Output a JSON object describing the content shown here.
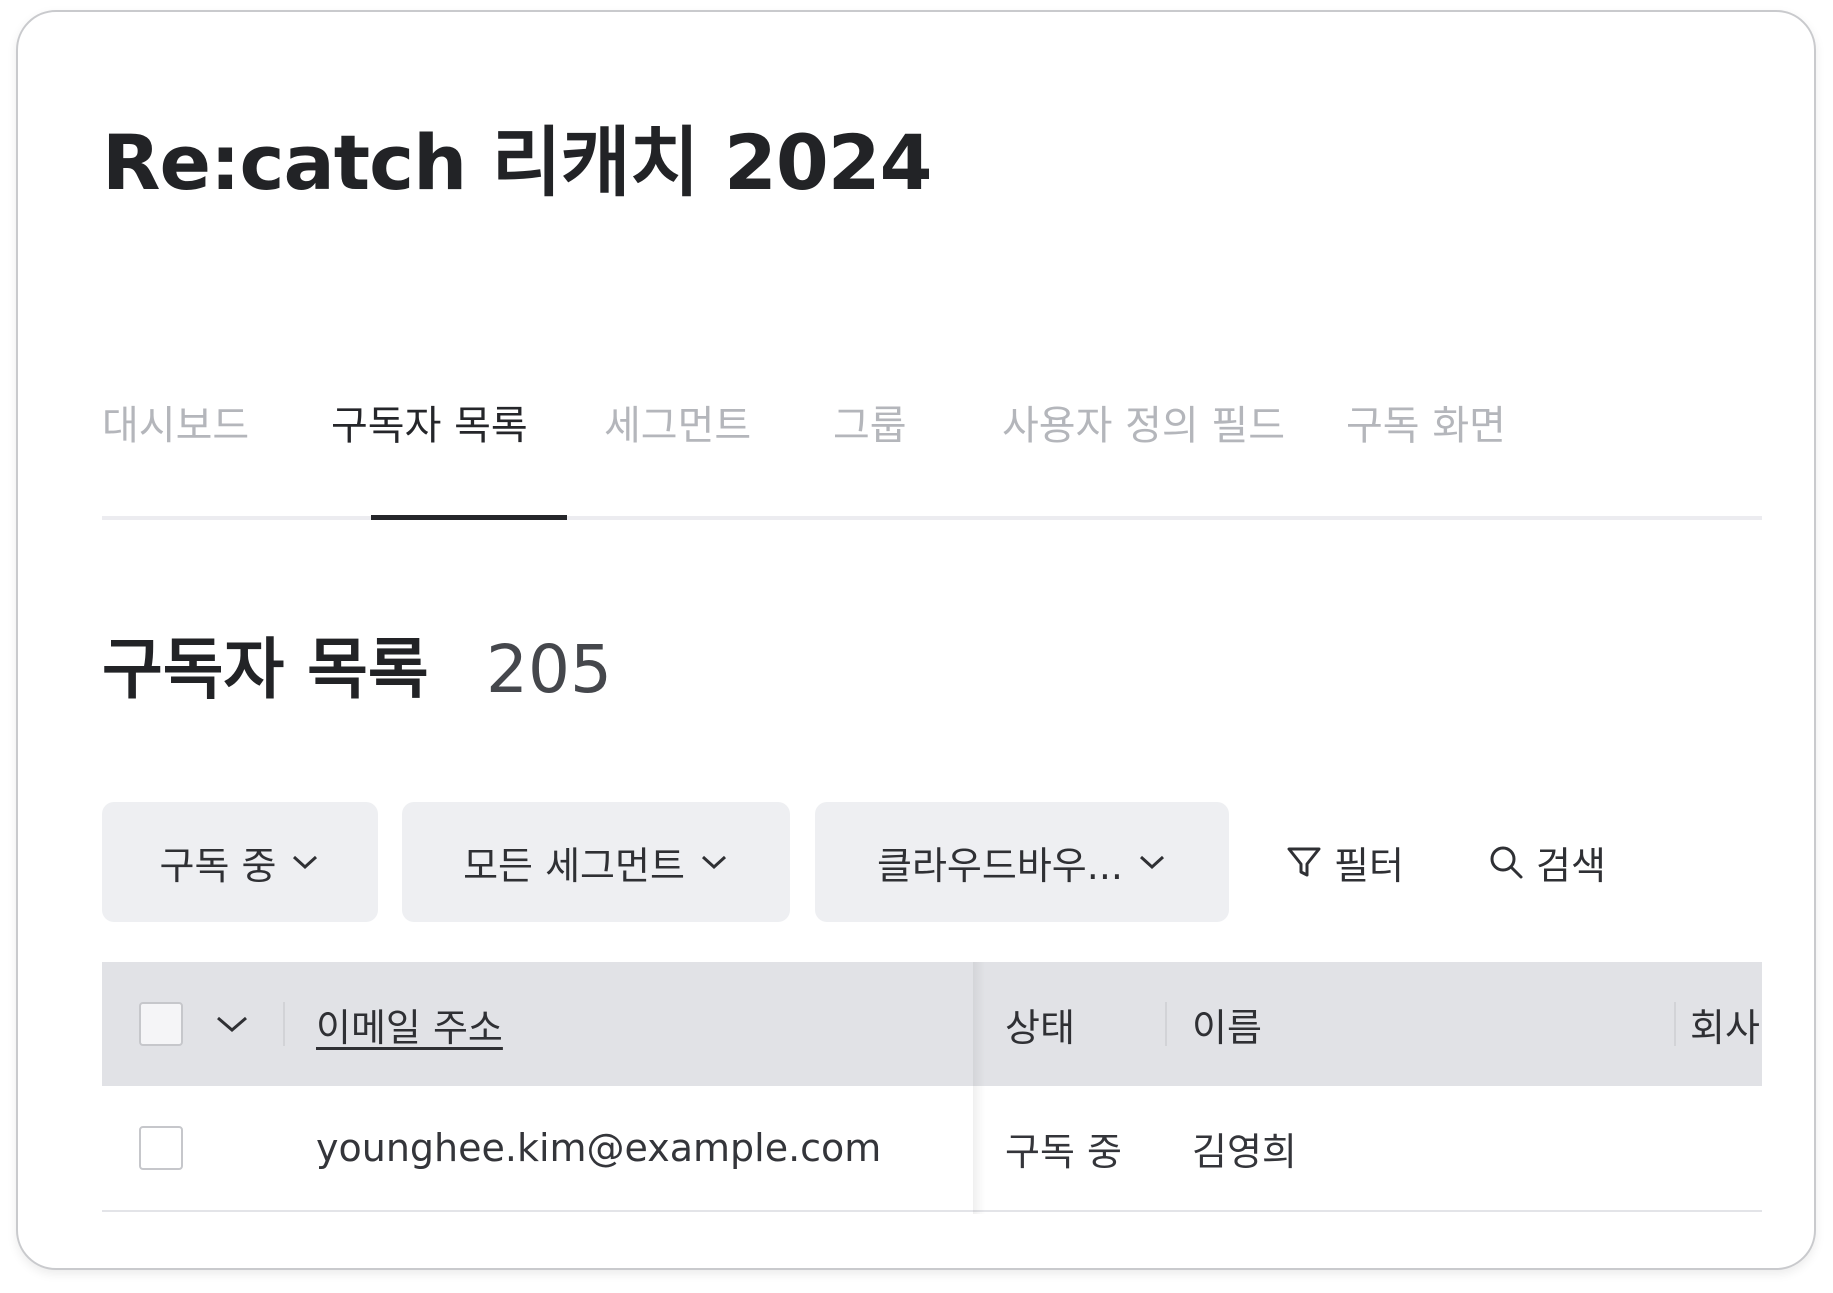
{
  "page": {
    "title": "Re:catch 리캐치 2024"
  },
  "tabs": [
    {
      "label": "대시보드",
      "active": false
    },
    {
      "label": "구독자 목록",
      "active": true
    },
    {
      "label": "세그먼트",
      "active": false
    },
    {
      "label": "그룹",
      "active": false
    },
    {
      "label": "사용자 정의 필드",
      "active": false
    },
    {
      "label": "구독 화면",
      "active": false
    }
  ],
  "list": {
    "heading": "구독자 목록",
    "count": "205"
  },
  "filters": {
    "status": "구독 중",
    "segment": "모든 세그먼트",
    "group": "클라우드바우...",
    "filter_label": "필터",
    "search_label": "검색"
  },
  "table": {
    "columns": {
      "email": "이메일 주소",
      "status": "상태",
      "name": "이름",
      "company": "회사"
    },
    "rows": [
      {
        "email": "younghee.kim@example.com",
        "status": "구독 중",
        "name": "김영희",
        "company": ""
      }
    ]
  },
  "colors": {
    "text_primary": "#222326",
    "tab_inactive": "#b4b6bb",
    "button_bg": "#eeeff2",
    "table_header_bg": "#e1e2e6"
  },
  "icons": {
    "chevron": "chevron-down-icon",
    "filter": "funnel-icon",
    "search": "search-icon"
  }
}
